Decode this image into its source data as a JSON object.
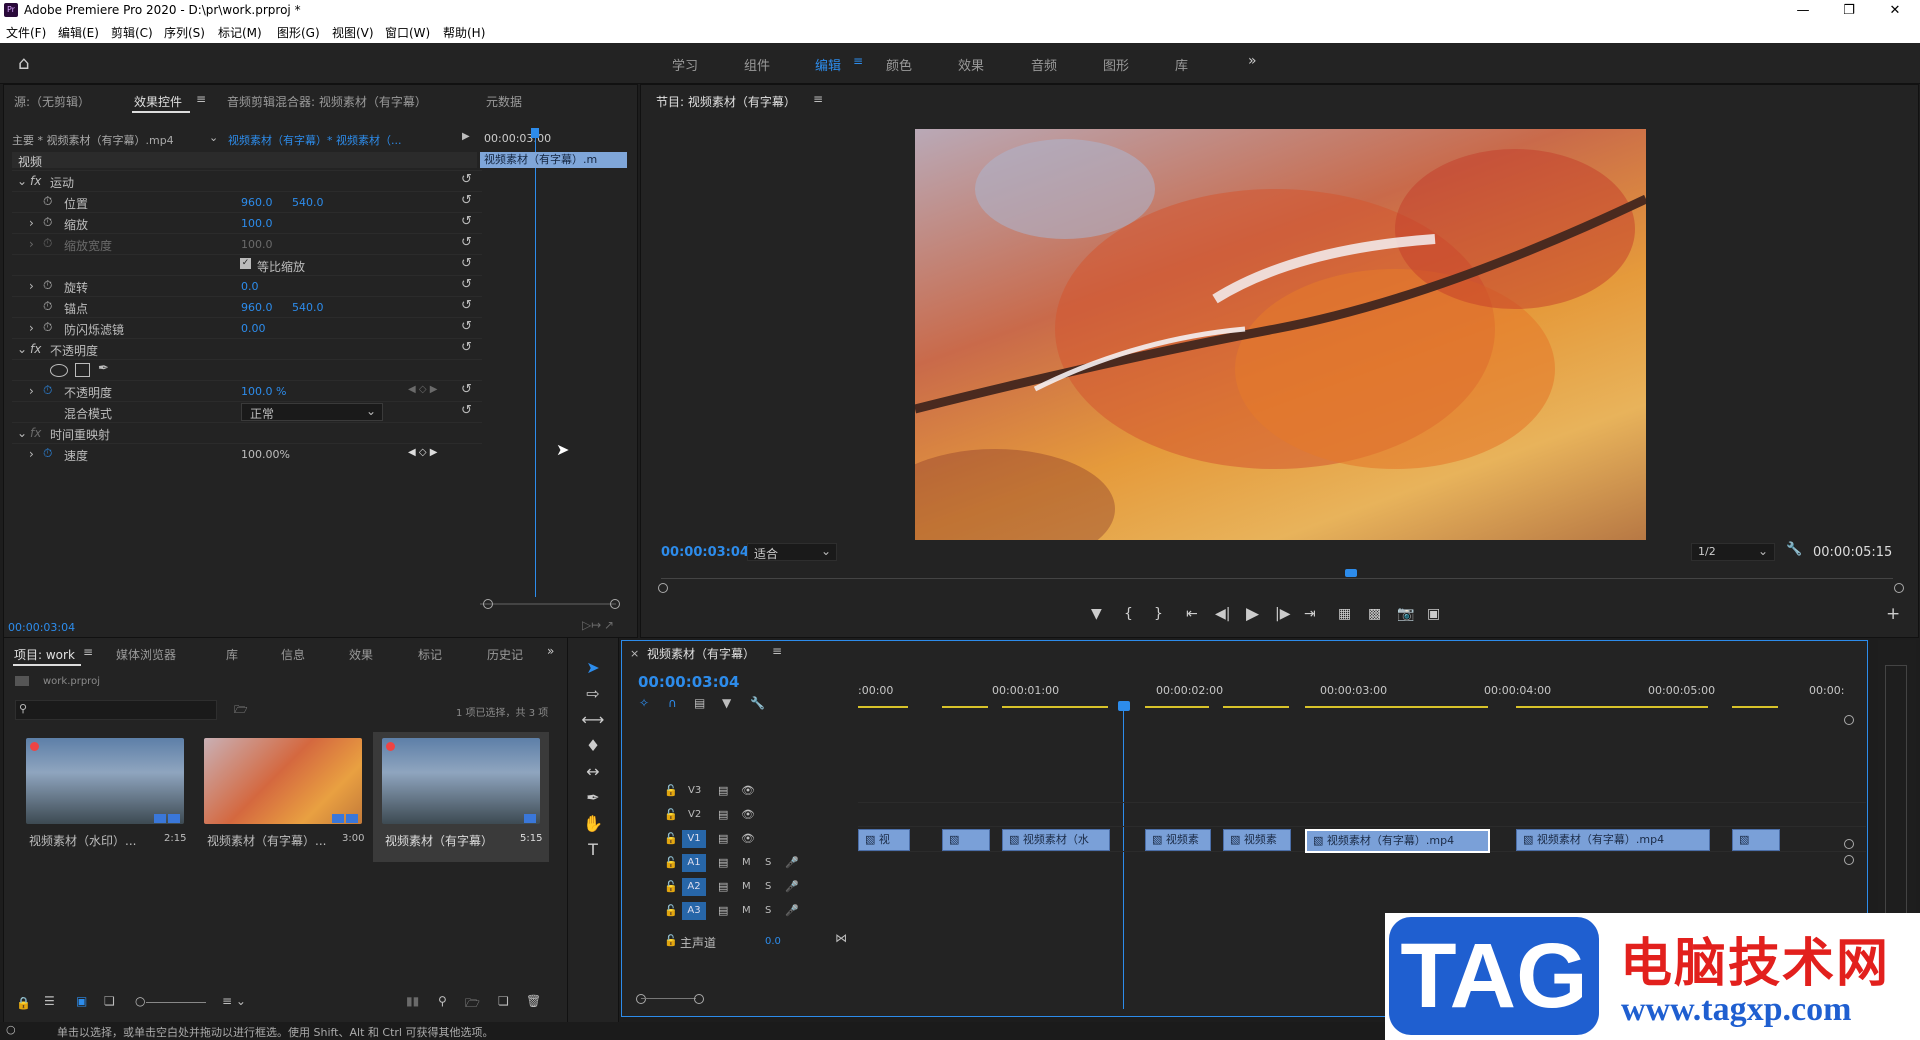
{
  "window": {
    "title": "Adobe Premiere Pro 2020 - D:\\pr\\work.prproj *",
    "app_icon": "Pr"
  },
  "menu": [
    "文件(F)",
    "编辑(E)",
    "剪辑(C)",
    "序列(S)",
    "标记(M)",
    "图形(G)",
    "视图(V)",
    "窗口(W)",
    "帮助(H)"
  ],
  "workspaces": [
    "学习",
    "组件",
    "编辑",
    "颜色",
    "效果",
    "音频",
    "图形",
    "库"
  ],
  "active_workspace": "编辑",
  "source_panel": {
    "tabs": [
      "源:（无剪辑）",
      "效果控件",
      "音频剪辑混合器: 视频素材（有字幕）",
      "元数据"
    ],
    "active_tab": "效果控件",
    "master_clip": "主要 * 视频素材（有字幕）.mp4",
    "sequence_clip": "视频素材（有字幕）* 视频素材（...",
    "mini_time": "00:00:03:00",
    "mini_clip": "视频素材（有字幕）.m",
    "section": "视频",
    "rows": [
      {
        "label": "运动",
        "v1": "",
        "v2": ""
      },
      {
        "label": "位置",
        "v1": "960.0",
        "v2": "540.0"
      },
      {
        "label": "缩放",
        "v1": "100.0",
        "v2": ""
      },
      {
        "label": "缩放宽度",
        "v1": "100.0",
        "v2": ""
      },
      {
        "label": "等比缩放",
        "v1": "",
        "v2": ""
      },
      {
        "label": "旋转",
        "v1": "0.0",
        "v2": ""
      },
      {
        "label": "锚点",
        "v1": "960.0",
        "v2": "540.0"
      },
      {
        "label": "防闪烁滤镜",
        "v1": "0.00",
        "v2": ""
      },
      {
        "label": "不透明度",
        "v1": "",
        "v2": ""
      },
      {
        "label": "不透明度",
        "v1": "100.0 %",
        "v2": ""
      },
      {
        "label": "混合模式",
        "v1": "正常",
        "v2": ""
      },
      {
        "label": "时间重映射",
        "v1": "",
        "v2": ""
      },
      {
        "label": "速度",
        "v1": "100.00%",
        "v2": ""
      }
    ],
    "fx": "fx",
    "timecode": "00:00:03:04"
  },
  "program": {
    "title": "节目: 视频素材（有字幕）",
    "timecode": "00:00:03:04",
    "fit": "适合",
    "resolution": "1/2",
    "duration": "00:00:05:15",
    "playhead": 0.56
  },
  "project": {
    "tabs": [
      "项目: work",
      "媒体浏览器",
      "库",
      "信息",
      "效果",
      "标记",
      "历史记"
    ],
    "file": "work.prproj",
    "selection": "1 项已选择，共 3 项",
    "items": [
      {
        "name": "视频素材（水印）...",
        "duration": "2:15",
        "colors": [
          "#5d7fa8",
          "#3d4a52"
        ]
      },
      {
        "name": "视频素材（有字幕）...",
        "duration": "3:00",
        "colors": [
          "#d08a4a",
          "#7a3a2a"
        ]
      },
      {
        "name": "视频素材（有字幕）",
        "duration": "5:15",
        "colors": [
          "#5d7fa8",
          "#3d4a52"
        ]
      }
    ]
  },
  "timeline": {
    "title": "视频素材（有字幕）",
    "timecode": "00:00:03:04",
    "ticks": [
      ":00:00",
      "00:00:01:00",
      "00:00:02:00",
      "00:00:03:00",
      "00:00:04:00",
      "00:00:05:00",
      "00:00:"
    ],
    "tracks": [
      "V3",
      "V2",
      "V1",
      "A1",
      "A2",
      "A3"
    ],
    "master": "主声道",
    "master_val": "0.0",
    "m": "M",
    "s": "S",
    "clips": [
      "视",
      "",
      "视频素材（水",
      "视频素",
      "视频素",
      "视频素材（有字幕）.mp4",
      "视频素材（有字幕）.mp4",
      ""
    ]
  },
  "status": "单击以选择，或单击空白处并拖动以进行框选。使用 Shift、Alt 和 Ctrl 可获得其他选项。",
  "watermark": {
    "tag": "TAG",
    "site_cn": "电脑技术网",
    "site_url": "www.tagxp.com"
  }
}
